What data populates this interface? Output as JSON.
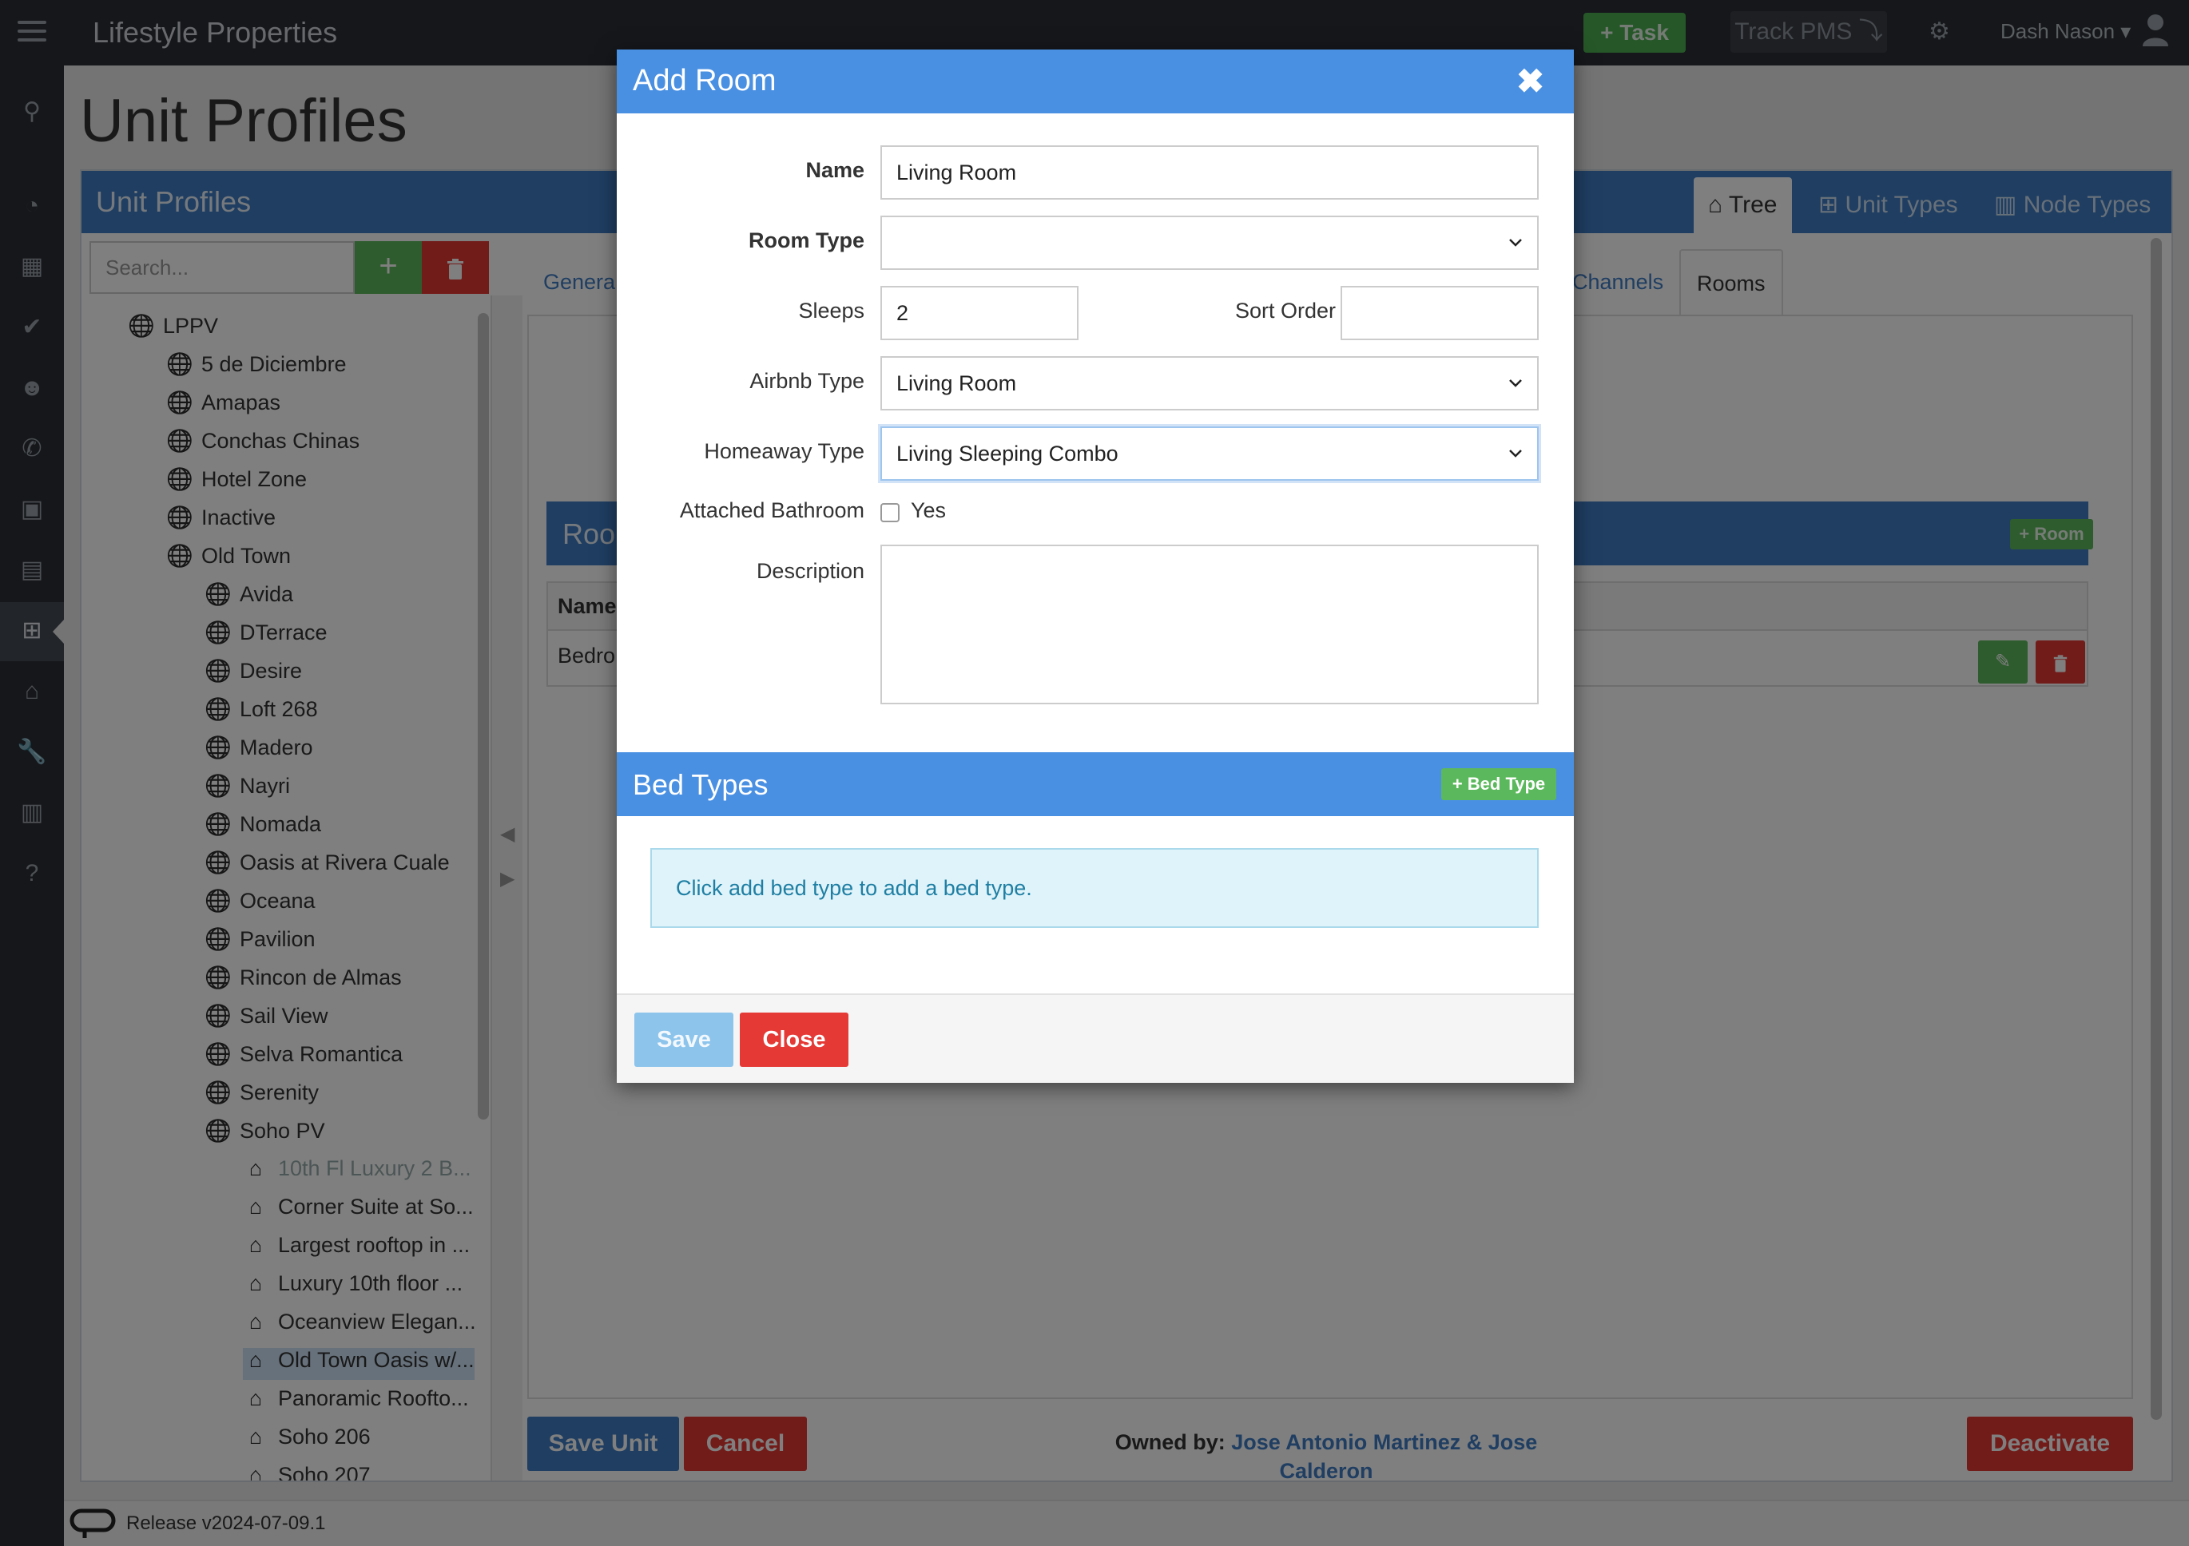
{
  "navbar": {
    "brand": "Lifestyle Properties",
    "task_label": "+ Task",
    "track_label": "Track PMS ⤵",
    "user_name": "Dash Nason ▾"
  },
  "page": {
    "title": "Unit Profiles",
    "panel_title": "Unit Profiles",
    "panel_tabs": [
      "Tree",
      "Unit Types",
      "Node Types"
    ],
    "search_placeholder": "Search..."
  },
  "tree": {
    "root": "LPPV",
    "level1": [
      "5 de Diciembre",
      "Amapas",
      "Conchas Chinas",
      "Hotel Zone",
      "Inactive",
      "Old Town"
    ],
    "old_town_children": [
      "Avida",
      "DTerrace",
      "Desire",
      "Loft 268",
      "Madero",
      "Nayri",
      "Nomada",
      "Oasis at Rivera Cuale",
      "Oceana",
      "Pavilion",
      "Rincon de Almas",
      "Sail View",
      "Selva Romantica",
      "Serenity",
      "Soho PV"
    ],
    "soho_children": [
      "10th Fl Luxury 2 B...",
      "Corner Suite at So...",
      "Largest rooftop in ...",
      "Luxury 10th floor ...",
      "Oceanview Elegan...",
      "Old Town Oasis w/...",
      "Panoramic Roofto...",
      "Soho 206",
      "Soho 207"
    ]
  },
  "content": {
    "tabs_visible": [
      "Genera",
      "Channels",
      "Rooms"
    ],
    "rooms_header": "Roo",
    "add_room_label": "+ Room",
    "table_header_name": "Name",
    "row_name": "Bedro",
    "save_unit": "Save Unit",
    "cancel": "Cancel",
    "owned_by_label": "Owned by:",
    "owned_by_names": "Jose Antonio Martinez & Jose Calderon",
    "deactivate": "Deactivate"
  },
  "footer": {
    "release": "Release v2024-07-09.1"
  },
  "modal": {
    "title": "Add Room",
    "close_glyph": "✖",
    "fields": {
      "name_label": "Name",
      "name_value": "Living Room",
      "room_type_label": "Room Type",
      "room_type_value": "",
      "sleeps_label": "Sleeps",
      "sleeps_value": "2",
      "sort_order_label": "Sort Order",
      "sort_order_value": "",
      "airbnb_label": "Airbnb Type",
      "airbnb_value": "Living Room",
      "homeaway_label": "Homeaway Type",
      "homeaway_value": "Living Sleeping Combo",
      "attached_bath_label": "Attached Bathroom",
      "attached_bath_option": "Yes",
      "attached_bath_checked": false,
      "description_label": "Description",
      "description_value": ""
    },
    "bed_types": {
      "title": "Bed Types",
      "add_label": "+ Bed Type",
      "empty_message": "Click add bed type to add a bed type."
    },
    "footer": {
      "save": "Save",
      "close": "Close"
    }
  },
  "colors": {
    "primary": "#4a90e2",
    "success": "#5cb85c",
    "danger": "#e53935",
    "navbar": "#2b2f36"
  }
}
